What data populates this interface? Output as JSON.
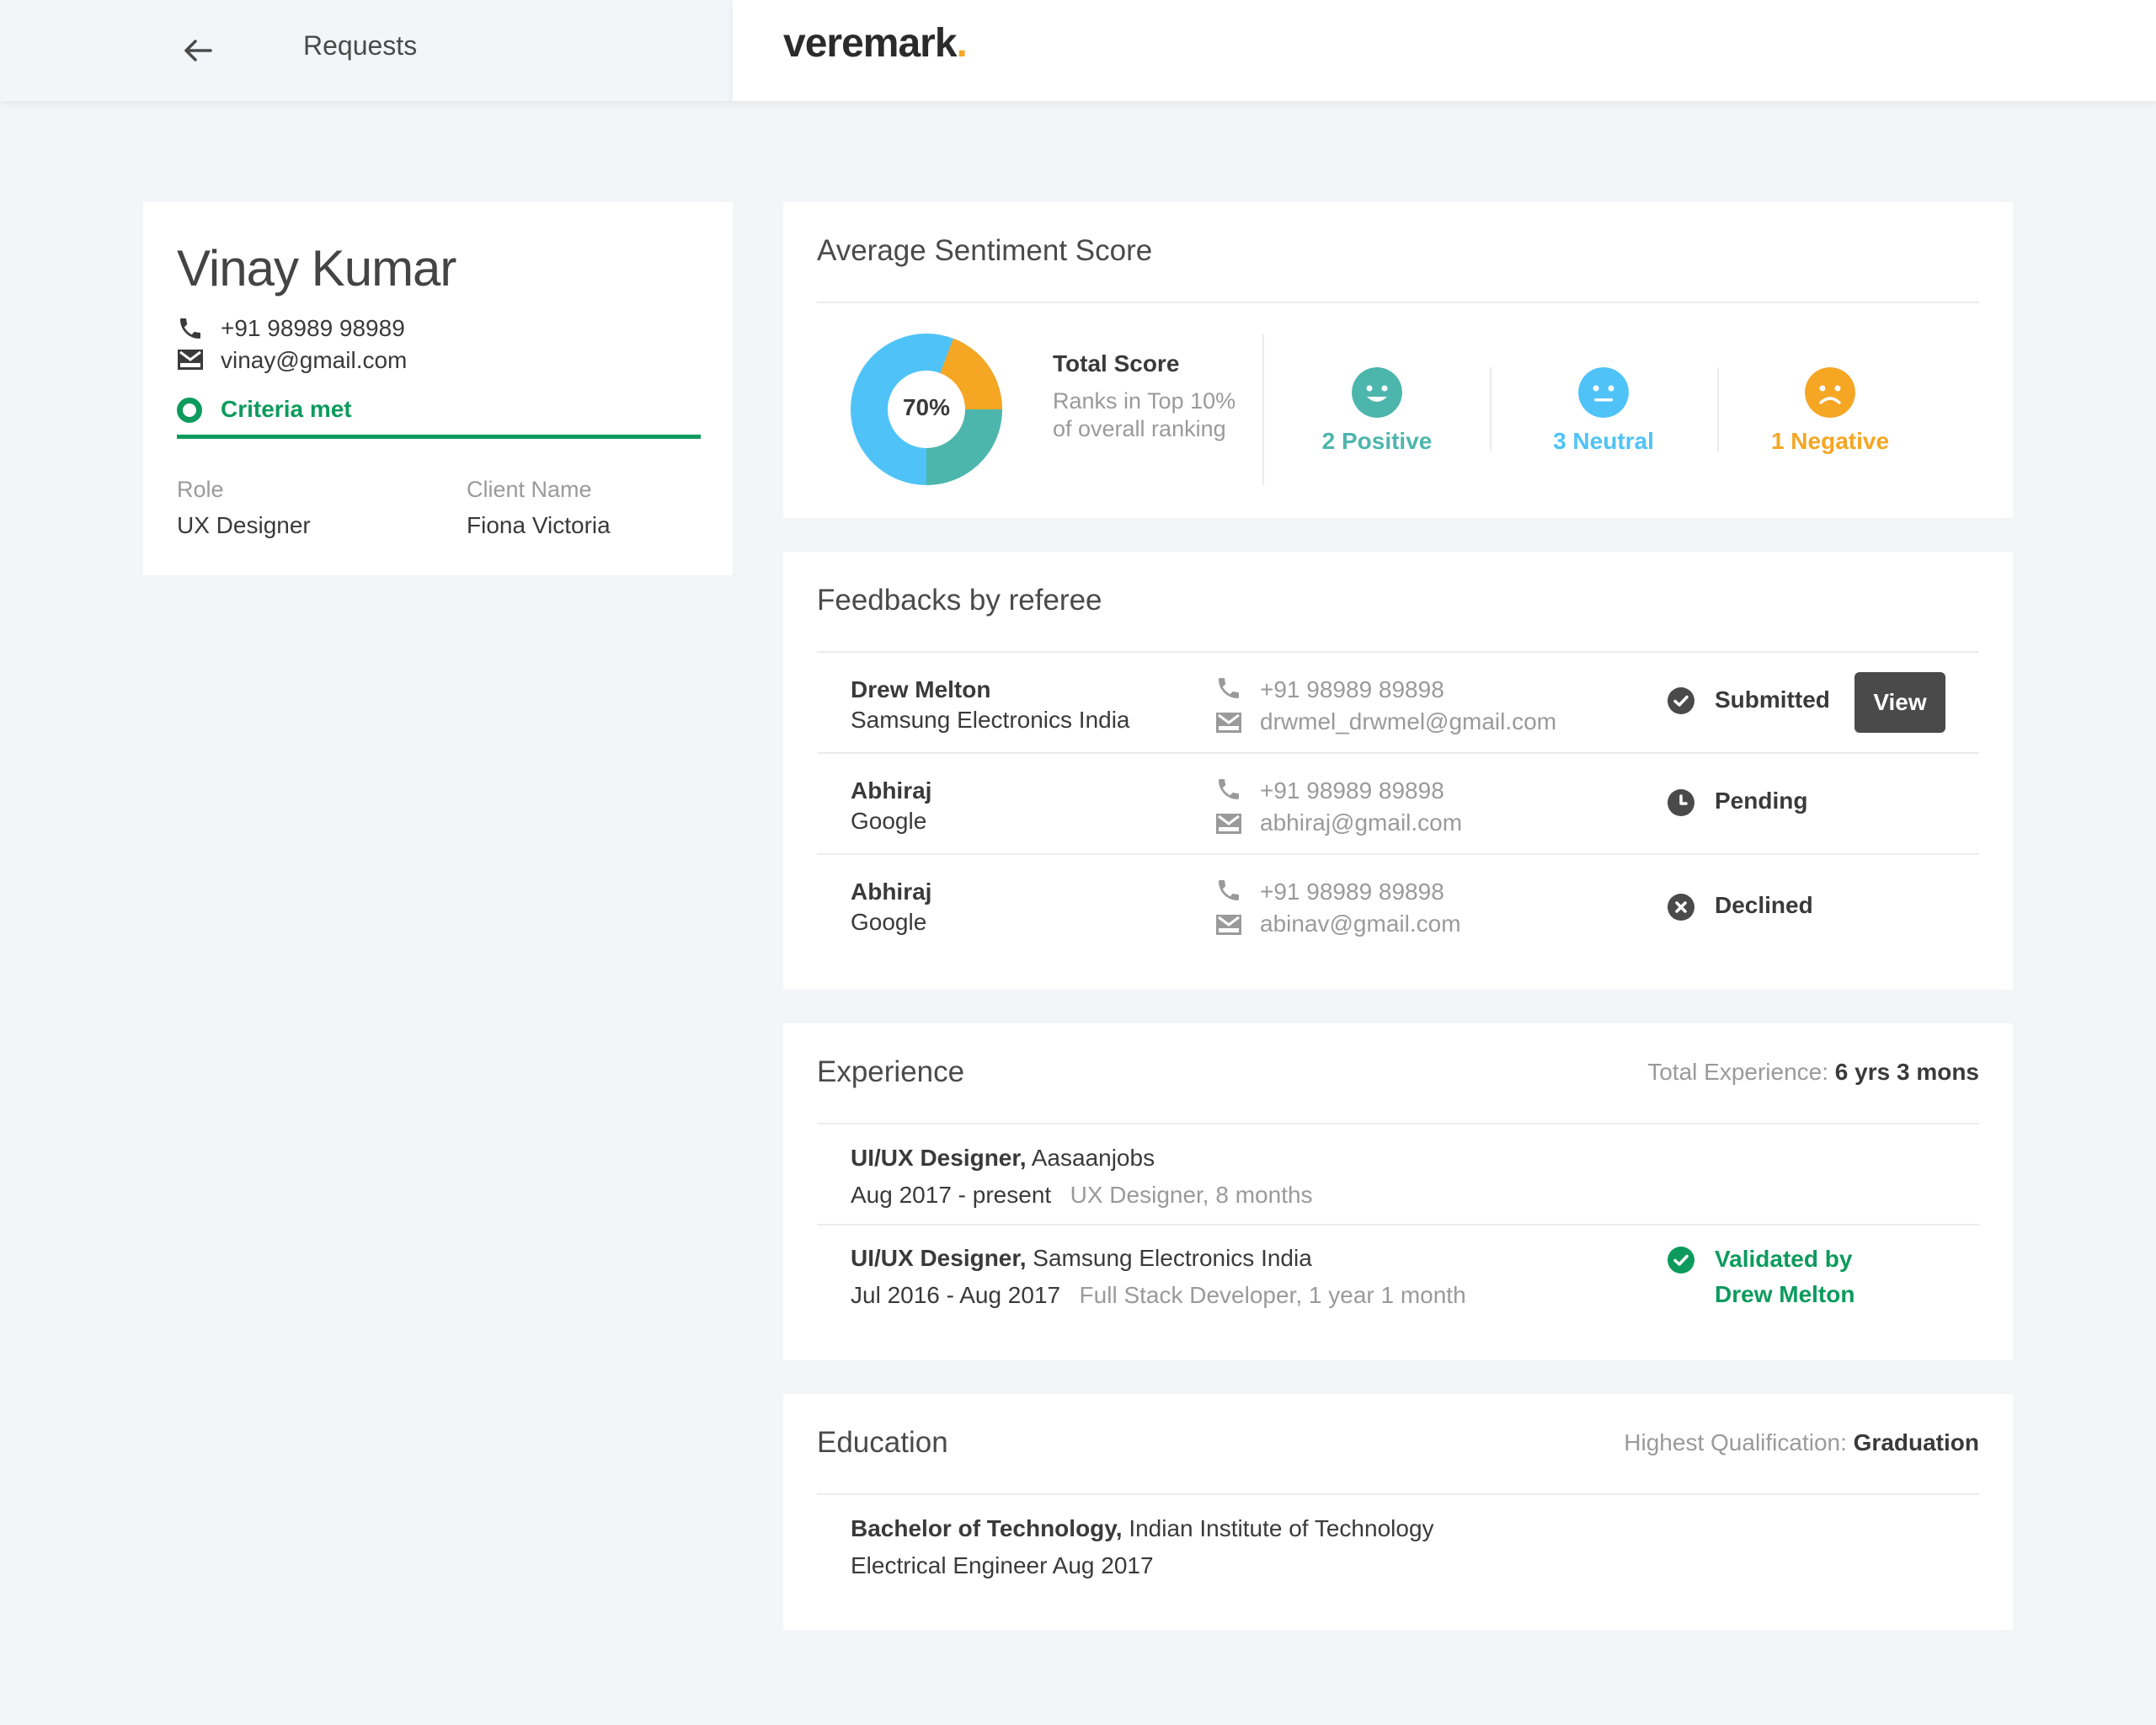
{
  "header": {
    "back_label": "Requests",
    "logo_text": "veremark",
    "logo_dot": "."
  },
  "profile": {
    "name": "Vinay Kumar",
    "phone": "+91 98989 98989",
    "email": "vinay@gmail.com",
    "criteria": "Criteria met",
    "role_label": "Role",
    "role_value": "UX Designer",
    "client_label": "Client Name",
    "client_value": "Fiona Victoria"
  },
  "sentiment": {
    "title": "Average Sentiment Score",
    "score": "70%",
    "score_value": 70,
    "total_label": "Total Score",
    "rank_text": "Ranks in Top 10% of overall ranking",
    "positive": "2 Positive",
    "neutral": "3 Neutral",
    "negative": "1 Negative",
    "colors": {
      "positive": "#4db6ac",
      "neutral": "#4fc3f7",
      "negative": "#f5a623"
    }
  },
  "feedback": {
    "title": "Feedbacks by referee",
    "rows": [
      {
        "name": "Drew Melton",
        "org": "Samsung Electronics India",
        "phone": "+91 98989 89898",
        "email": "drwmel_drwmel@gmail.com",
        "status": "Submitted",
        "status_icon": "check-circle-icon",
        "action": "View"
      },
      {
        "name": "Abhiraj",
        "org": "Google",
        "phone": "+91 98989 89898",
        "email": "abhiraj@gmail.com",
        "status": "Pending",
        "status_icon": "clock-icon"
      },
      {
        "name": "Abhiraj",
        "org": "Google",
        "phone": "+91 98989 89898",
        "email": "abinav@gmail.com",
        "status": "Declined",
        "status_icon": "x-circle-icon"
      }
    ]
  },
  "experience": {
    "title": "Experience",
    "total_label": "Total Experience:",
    "total_value": "6 yrs 3 mons",
    "items": [
      {
        "role": "UI/UX Designer,",
        "company": "Aasaanjobs",
        "dates": "Aug 2017 - present",
        "meta": "UX Designer, 8 months"
      },
      {
        "role": "UI/UX Designer,",
        "company": "Samsung Electronics India",
        "dates": "Jul 2016 - Aug 2017",
        "meta": "Full Stack Developer, 1 year 1 month",
        "validated_line1": "Validated by",
        "validated_line2": "Drew Melton"
      }
    ]
  },
  "education": {
    "title": "Education",
    "highest_label": "Highest Qualification:",
    "highest_value": "Graduation",
    "degree": "Bachelor of Technology,",
    "institute": "Indian Institute of Technology",
    "detail": "Electrical Engineer Aug 2017"
  }
}
